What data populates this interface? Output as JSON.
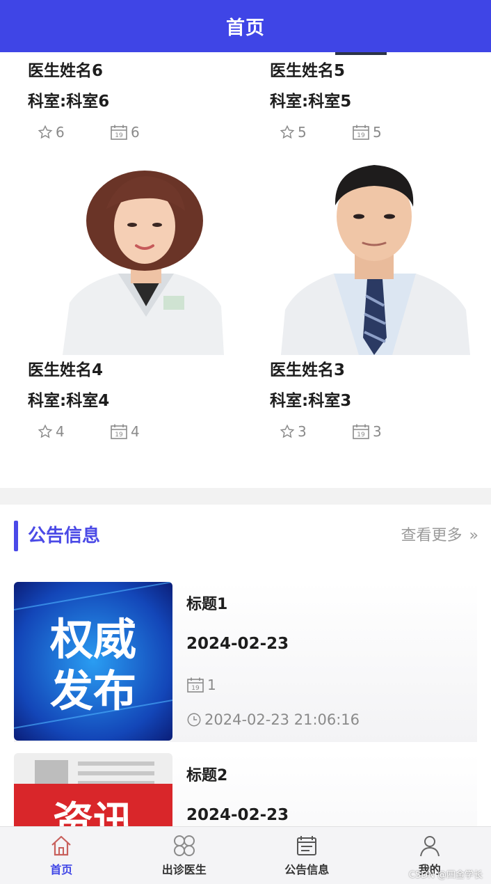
{
  "header": {
    "title": "首页"
  },
  "doctors": [
    {
      "name": "医生姓名6",
      "dept": "科室:科室6",
      "favorites": "6",
      "appointments": "6"
    },
    {
      "name": "医生姓名5",
      "dept": "科室:科室5",
      "favorites": "5",
      "appointments": "5"
    },
    {
      "name": "医生姓名4",
      "dept": "科室:科室4",
      "favorites": "4",
      "appointments": "4"
    },
    {
      "name": "医生姓名3",
      "dept": "科室:科室3",
      "favorites": "3",
      "appointments": "3"
    }
  ],
  "notices": {
    "section_title": "公告信息",
    "more_label": "查看更多",
    "items": [
      {
        "title": "标题1",
        "date": "2024-02-23",
        "views": "1",
        "time": "2024-02-23 21:06:16",
        "thumb_text_1": "权威",
        "thumb_text_2": "发布"
      },
      {
        "title": "标题2",
        "date": "2024-02-23",
        "thumb_text_1": "资讯"
      }
    ]
  },
  "tabs": [
    {
      "label": "首页",
      "icon": "home-icon",
      "active": true
    },
    {
      "label": "出诊医生",
      "icon": "grid-icon",
      "active": false
    },
    {
      "label": "公告信息",
      "icon": "notice-icon",
      "active": false
    },
    {
      "label": "我的",
      "icon": "user-icon",
      "active": false
    }
  ],
  "watermark": "CSDN @四金学长",
  "colors": {
    "primary": "#3f45e6",
    "muted": "#8a8a8a",
    "accent_home": "#c8605c"
  }
}
